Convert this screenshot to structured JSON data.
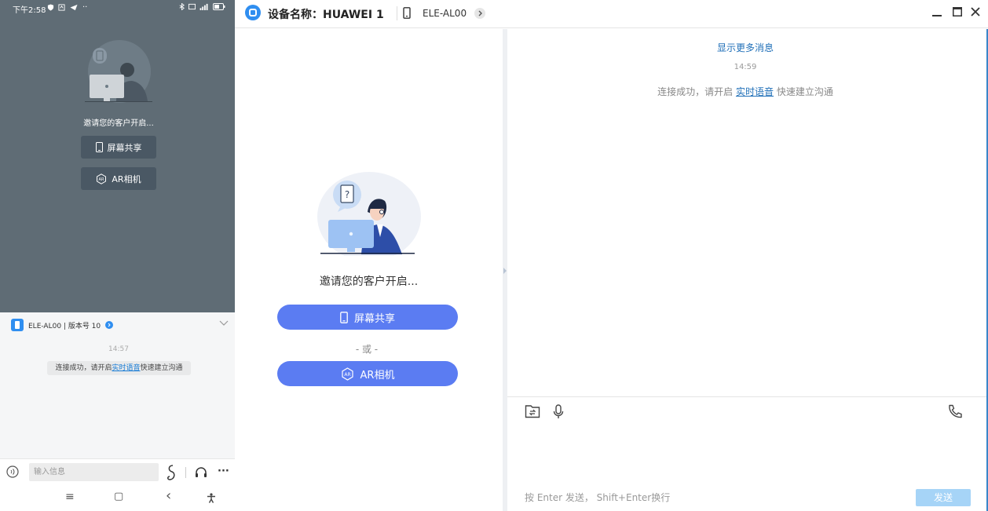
{
  "phone": {
    "status_time": "下午2:58",
    "status_dots": "··",
    "invite_text": "邀请您的客户开启...",
    "screen_share_label": "屏幕共享",
    "ar_camera_label": "AR相机",
    "sheet": {
      "device_info": "ELE-AL00 | 版本号 10",
      "time": "14:57",
      "sysmsg_prefix": "连接成功，请开启",
      "sysmsg_link": "实时语音",
      "sysmsg_suffix": "快速建立沟通"
    },
    "input_placeholder": "输入信息",
    "more_label": "···",
    "nav": {
      "menu": "≡",
      "home": "▢",
      "back": "‹",
      "accessibility": "⚲"
    }
  },
  "titlebar": {
    "device_name": "设备名称：HUAWEI 1",
    "device_model": "ELE-AL00"
  },
  "main": {
    "invite_text": "邀请您的客户开启...",
    "screen_share_label": "屏幕共享",
    "or_text": "- 或 -",
    "ar_camera_label": "AR相机"
  },
  "chat": {
    "show_more": "显示更多消息",
    "time": "14:59",
    "sysmsg_prefix": "连接成功，请开启 ",
    "sysmsg_link": "实时语音",
    "sysmsg_suffix": " 快速建立沟通",
    "hint": "按 Enter 发送，  Shift+Enter换行",
    "send_label": "发送"
  },
  "colors": {
    "accent": "#5b7cf2",
    "link": "#1f6fb8",
    "send_disabled": "#a6d4f7",
    "phone_overlay": "#5f6c75"
  },
  "icons": [
    "app-logo-icon",
    "phone-icon",
    "chevron-right-icon",
    "minimize-icon",
    "maximize-icon",
    "close-icon",
    "file-icon",
    "mic-icon",
    "phone-call-icon",
    "ar-icon",
    "mobile-icon"
  ]
}
